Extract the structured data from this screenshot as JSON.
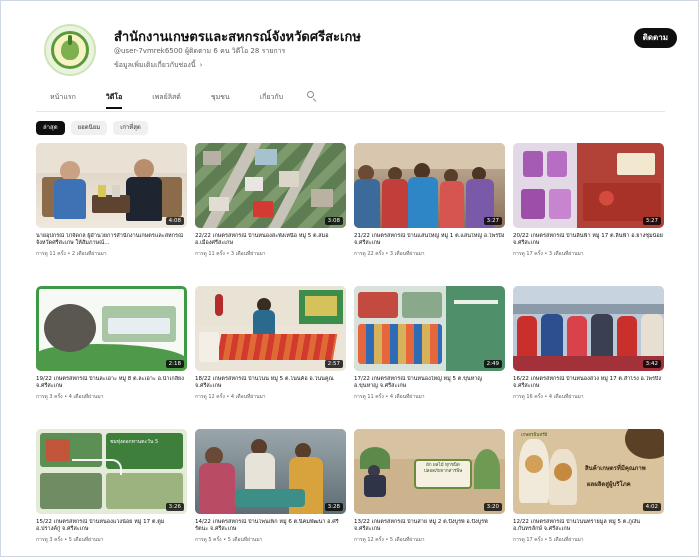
{
  "channel": {
    "title": "สำนักงานเกษตรและสหกรณ์จังหวัดศรีสะเกษ",
    "meta": "@user-7vmrek6500 ผู้ติดตาม 6 คน วิดีโอ 28 รายการ",
    "description": "ข้อมูลเพิ่มเติมเกี่ยวกับช่องนี้",
    "subscribe_label": "ติดตาม"
  },
  "tabs": [
    {
      "label": "หน้าแรก"
    },
    {
      "label": "วิดีโอ"
    },
    {
      "label": "เพลย์ลิสต์"
    },
    {
      "label": "ชุมชน"
    },
    {
      "label": "เกี่ยวกับ"
    }
  ],
  "chips": [
    {
      "label": "ล่าสุด"
    },
    {
      "label": "ยอดนิยม"
    },
    {
      "label": "เก่าที่สุด"
    }
  ],
  "videos": [
    {
      "title": "นายอุปกรณ์ ไก่จัดกล ผู้อำนวยการสำนักงานเกษตรและสหกรณ์จังหวัดศรีสะเกษ ให้สัมภาษณ์...",
      "meta": "การดู 11 ครั้ง • 2 เดือนที่ผ่านมา",
      "duration": "4:08"
    },
    {
      "title": "22/22 เกษตรสหกรณ์ บ้านหนองสะพังเหนือ หมู่ 5 ต.สมอ อ.เมืองศรีสะเกษ",
      "meta": "การดู 11 ครั้ง • 3 เดือนที่ผ่านมา",
      "duration": "3:08"
    },
    {
      "title": "21/22 เกษตรสหกรณ์ บ้านแสนใหญ่ หมู่ 1 ต.แสนใหญ่ อ.ไพรบึง จ.ศรีสะเกษ",
      "meta": "การดู 22 ครั้ง • 3 เดือนที่ผ่านมา",
      "duration": "3:27"
    },
    {
      "title": "20/22 เกษตรสหกรณ์ บ้านลิ้นฟ้า หมู่ 17 ต.ลิ้นฟ้า อ.ยางชุมน้อย จ.ศรีสะเกษ",
      "meta": "การดู 17 ครั้ง • 3 เดือนที่ผ่านมา",
      "duration": "3:27"
    },
    {
      "title": "19/22 เกษตรสหกรณ์ บ้านละเอาะ หมู่ 8 ต.ละเอาะ อ.น้ำเกลี้ยง จ.ศรีสะเกษ",
      "meta": "การดู 3 ครั้ง • 4 เดือนที่ผ่านมา",
      "duration": "2:18"
    },
    {
      "title": "18/22 เกษตรสหกรณ์ บ้านโนน หมู่ 5 ต.โนนค้อ อ.โนนคูณ จ.ศรีสะเกษ",
      "meta": "การดู 12 ครั้ง • 4 เดือนที่ผ่านมา",
      "duration": "2:57"
    },
    {
      "title": "17/22 เกษตรสหกรณ์ บ้านหนองใหญ่ หมู่ 5 ต.ขุนหาญ อ.ขุนหาญ จ.ศรีสะเกษ",
      "meta": "การดู 11 ครั้ง • 4 เดือนที่ผ่านมา",
      "duration": "2:49"
    },
    {
      "title": "16/22 เกษตรสหกรณ์ บ้านหนองสวง หมู่ 17 ต.สำโรง อ.ไพรบึง จ.ศรีสะเกษ",
      "meta": "การดู 16 ครั้ง • 4 เดือนที่ผ่านมา",
      "duration": "3:42"
    },
    {
      "title": "15/22 เกษตรสหกรณ์ บ้านหนองแวงน้อย หมู่ 17 ต.ตูม อ.ปรางค์กู่ จ.ศรีสะเกษ",
      "meta": "การดู 3 ครั้ง • 5 เดือนที่ผ่านมา",
      "duration": "3:26"
    },
    {
      "title": "14/22 เกษตรสหกรณ์ บ้านโพนเพ็ก หมู่ 6 ต.นิคมพัฒนา อ.ศรีรัตนะ จ.ศรีสะเกษ",
      "meta": "การดู 5 ครั้ง • 5 เดือนที่ผ่านมา",
      "duration": "3:28"
    },
    {
      "title": "13/22 เกษตรสหกรณ์ บ้านสาย หมู่ 2 ต.บึงบูรพ์ อ.บึงบูรพ์ จ.ศรีสะเกษ",
      "meta": "การดู 12 ครั้ง • 5 เดือนที่ผ่านมา",
      "duration": "3:20"
    },
    {
      "title": "12/22 เกษตรสหกรณ์ บ้านโนนทรายมูล หมู่ 5 ต.ภูเงิน อ.กันทรลักษ์ จ.ศรีสะเกษ",
      "meta": "การดู 17 ครั้ง • 5 เดือนที่ผ่านมา",
      "duration": "4:02"
    }
  ],
  "thumb_text": {
    "t9_label": "ชมทุ่งดอกทานตะวัน 5",
    "t11_caption": "ผัก ผลไม้ ทุกชนิด ปลอดภัยจากสารพิษ",
    "t12_badge": "เกษตรอินทรีย์",
    "t12_line1": "สินค้าเกษตรที่มีคุณภาพ",
    "t12_line2": "ผลผลิตสู่ผู้บริโภค"
  },
  "colors": {
    "subscribe_bg": "#0f0f0f",
    "chip_active_bg": "#0f0f0f",
    "chip_bg": "#f0f0f0",
    "text_secondary": "#606060"
  }
}
